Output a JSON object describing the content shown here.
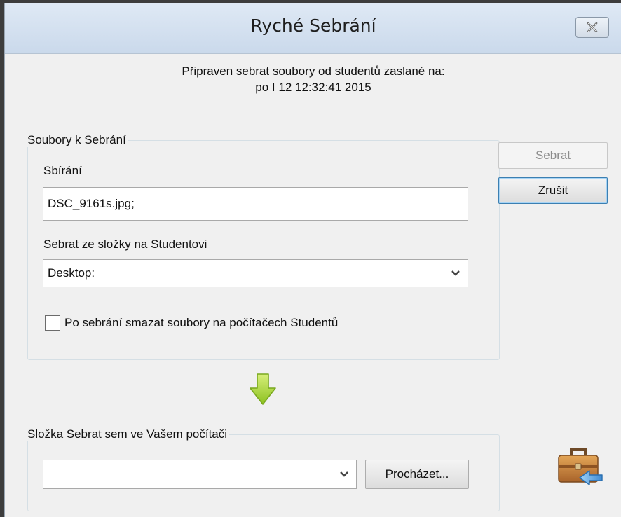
{
  "window": {
    "title": "Ryché Sebrání",
    "close_icon": "close-x-icon"
  },
  "header": {
    "line1": "Připraven sebrat soubory od studentů zaslané na:",
    "line2": "po I 12 12:32:41 2015"
  },
  "files_group": {
    "title": "Soubory k Sebrání",
    "collect_label": "Sbírání",
    "collect_value": "DSC_9161s.jpg;",
    "source_folder_label": "Sebrat ze složky na Studentovi",
    "source_folder_value": "Desktop:",
    "delete_checkbox_label": "Po sebrání smazat soubory na počítačech Studentů",
    "delete_checkbox_checked": false
  },
  "buttons": {
    "collect": "Sebrat",
    "collect_enabled": false,
    "cancel": "Zrušit"
  },
  "arrow_icon": "green-down-arrow-icon",
  "dest_group": {
    "title": "Složka Sebrat sem ve Vašem počítači",
    "dest_folder_value": "",
    "browse_button": "Procházet..."
  },
  "briefcase_icon": "briefcase-collect-icon",
  "colors": {
    "arrow_green": "#9acd32",
    "title_bar": "#d3e0ef",
    "dialog_bg": "#f0f0f0"
  }
}
